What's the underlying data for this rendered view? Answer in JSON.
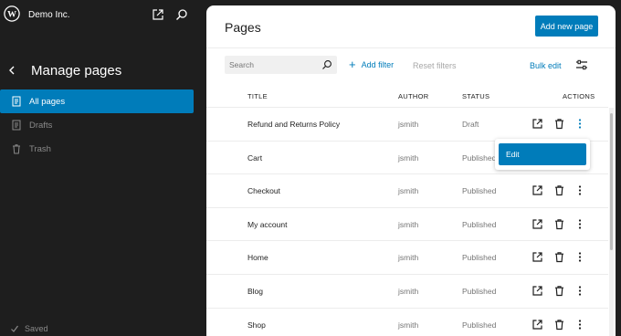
{
  "site": {
    "name": "Demo Inc."
  },
  "sidebar": {
    "title": "Manage pages",
    "items": [
      {
        "label": "All pages",
        "icon": "pages-icon",
        "active": true
      },
      {
        "label": "Drafts",
        "icon": "drafts-icon",
        "active": false
      },
      {
        "label": "Trash",
        "icon": "trash-icon",
        "active": false
      }
    ],
    "status": "Saved"
  },
  "main": {
    "title": "Pages",
    "add_new_label": "Add new page",
    "search_placeholder": "Search",
    "add_filter_label": "Add filter",
    "reset_filters_label": "Reset filters",
    "bulk_edit_label": "Bulk edit",
    "columns": {
      "title": "TITLE",
      "author": "AUTHOR",
      "status": "STATUS",
      "actions": "ACTIONS"
    },
    "rows": [
      {
        "title": "Refund and Returns Policy",
        "author": "jsmith",
        "status": "Draft"
      },
      {
        "title": "Cart",
        "author": "jsmith",
        "status": "Published"
      },
      {
        "title": "Checkout",
        "author": "jsmith",
        "status": "Published"
      },
      {
        "title": "My account",
        "author": "jsmith",
        "status": "Published"
      },
      {
        "title": "Home",
        "author": "jsmith",
        "status": "Published"
      },
      {
        "title": "Blog",
        "author": "jsmith",
        "status": "Published"
      },
      {
        "title": "Shop",
        "author": "jsmith",
        "status": "Published"
      }
    ],
    "context_menu": {
      "items": [
        "Edit"
      ]
    }
  },
  "colors": {
    "accent": "#007cba",
    "sidebar_bg": "#1e1e1e",
    "panel_bg": "#ffffff"
  }
}
